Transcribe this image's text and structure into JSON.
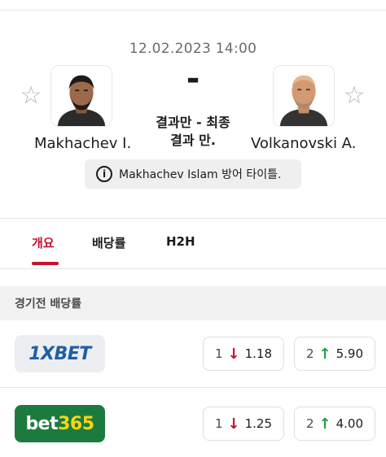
{
  "match": {
    "date": "12.02.2023 14:00",
    "score": "-",
    "status_line1": "결과만 - 최종",
    "status_line2": "결과 만."
  },
  "home": {
    "name": "Makhachev I.",
    "avatar_icon": "fighter-photo-icon"
  },
  "away": {
    "name": "Volkanovski A.",
    "avatar_icon": "fighter-photo-icon"
  },
  "info_banner": {
    "icon": "info-icon",
    "icon_glyph": "i",
    "text": "Makhachev Islam 방어 타이틀."
  },
  "tabs": [
    {
      "label": "개요",
      "active": true
    },
    {
      "label": "배당률",
      "active": false
    },
    {
      "label": "H2H",
      "active": false
    }
  ],
  "odds_section": {
    "title": "경기전 배당률",
    "rows": [
      {
        "bookmaker": "1XBET",
        "odds": [
          {
            "label": "1",
            "direction": "down",
            "arrow": "↓",
            "value": "1.18"
          },
          {
            "label": "2",
            "direction": "up",
            "arrow": "↑",
            "value": "5.90"
          }
        ]
      },
      {
        "bookmaker_part1": "bet",
        "bookmaker_part2": "365",
        "odds": [
          {
            "label": "1",
            "direction": "down",
            "arrow": "↓",
            "value": "1.25"
          },
          {
            "label": "2",
            "direction": "up",
            "arrow": "↑",
            "value": "4.00"
          }
        ]
      }
    ]
  },
  "colors": {
    "accent": "#c8102e",
    "up": "#1f9d4a",
    "down": "#c8102e"
  }
}
